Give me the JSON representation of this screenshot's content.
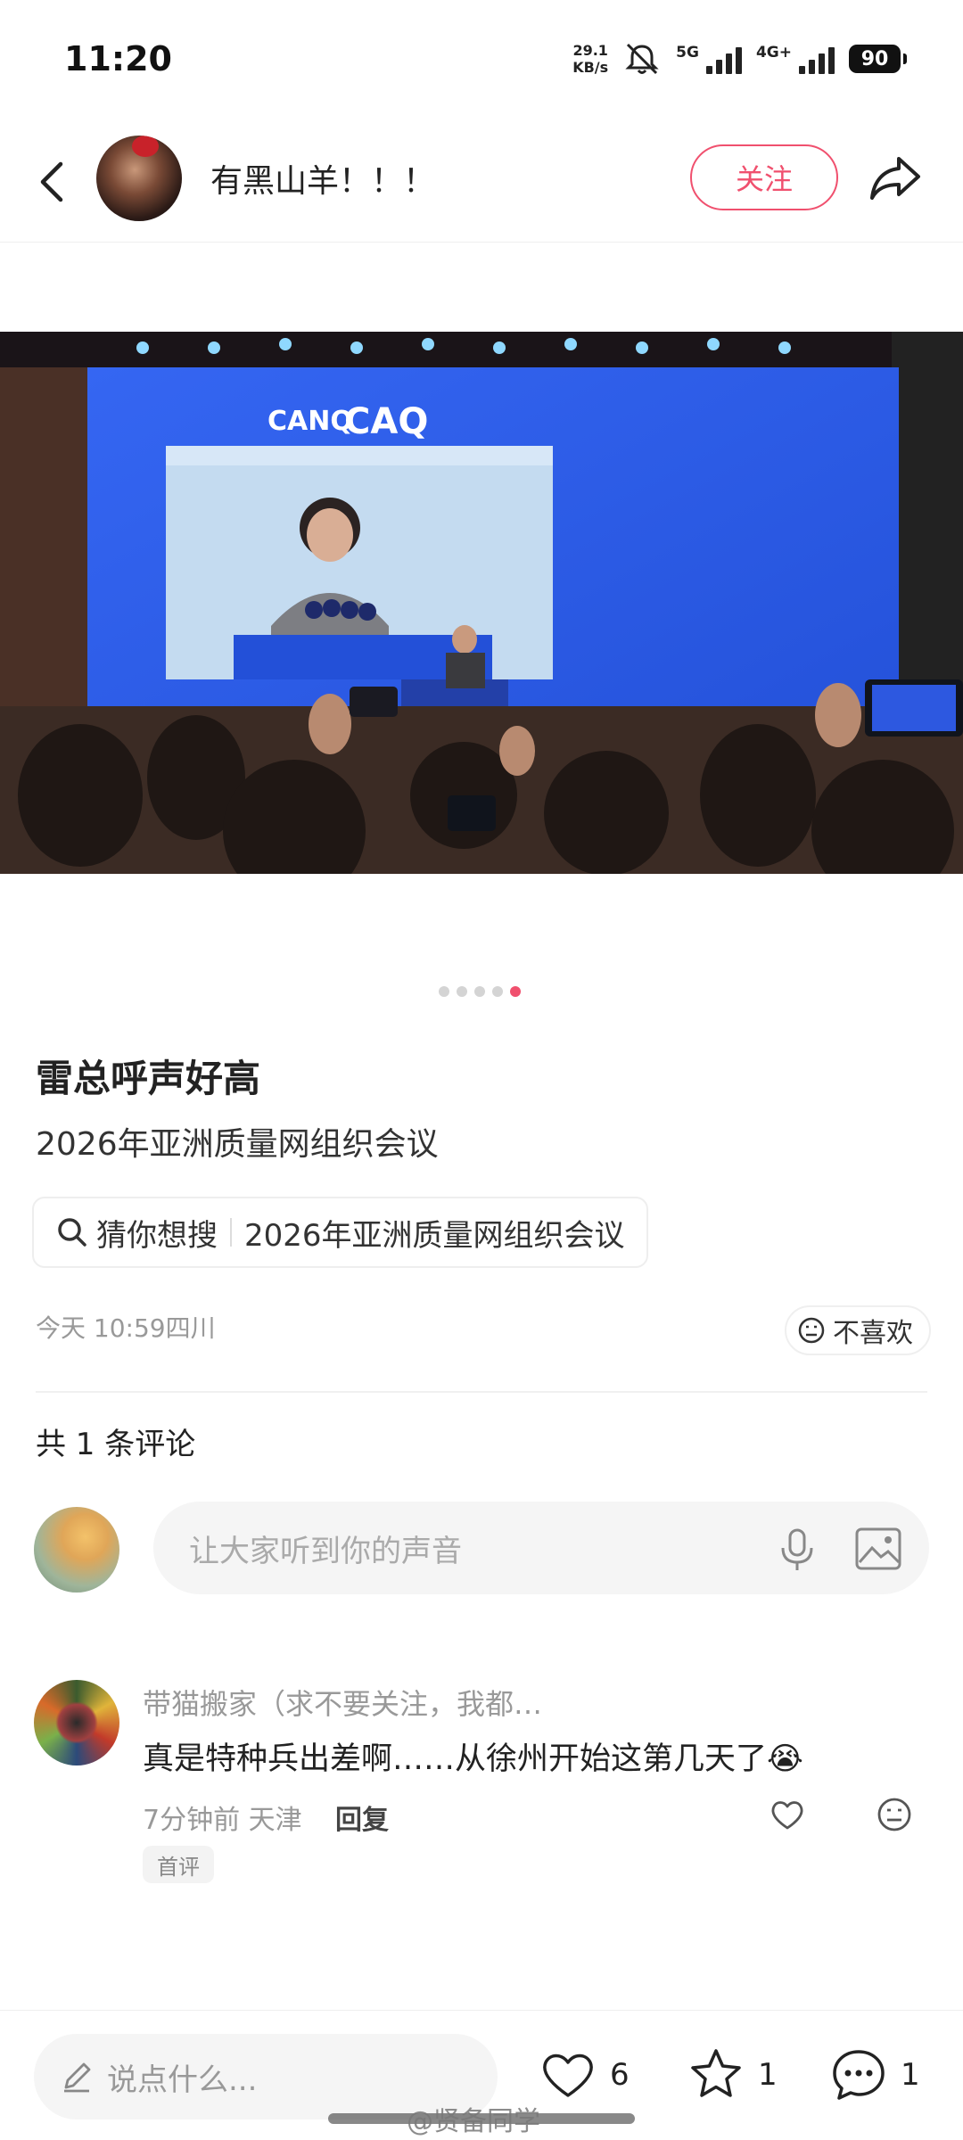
{
  "status": {
    "time": "11:20",
    "net_speed_value": "29.1",
    "net_speed_unit": "KB/s",
    "signal_1": "5G",
    "signal_2": "4G+",
    "battery": "90"
  },
  "header": {
    "username": "有黑山羊！！！",
    "follow_label": "关注"
  },
  "gallery": {
    "screen_logo_1": "CANQ",
    "screen_logo_2": "CAQ",
    "total_images": 5,
    "active_index": 5
  },
  "post": {
    "title": "雷总呼声好高",
    "body": "2026年亚洲质量网组织会议",
    "guess_label": "猜你想搜",
    "guess_query": "2026年亚洲质量网组织会议",
    "meta": "今天 10:59四川",
    "dislike_label": "不喜欢"
  },
  "comments": {
    "count_text": "共 1 条评论",
    "input_placeholder": "让大家听到你的声音",
    "items": [
      {
        "author": "带猫搬家（求不要关注，我都…",
        "text": "真是特种兵出差啊……从徐州开始这第几天了😭",
        "meta": "7分钟前 天津",
        "reply_label": "回复",
        "badge": "首评"
      }
    ]
  },
  "bottom": {
    "say_placeholder": "说点什么...",
    "likes": "6",
    "stars": "1",
    "comments": "1",
    "watermark": "@贤备同学"
  },
  "colors": {
    "accent": "#f0506e",
    "screen_blue": "#2b5ef0",
    "text_primary": "#222222",
    "text_secondary": "#999999"
  },
  "icons": [
    "back-icon",
    "share-icon",
    "search-icon",
    "dislike-face-icon",
    "microphone-icon",
    "image-icon",
    "heart-icon",
    "star-icon",
    "comment-bubble-icon",
    "pencil-icon",
    "bell-muted-icon"
  ]
}
